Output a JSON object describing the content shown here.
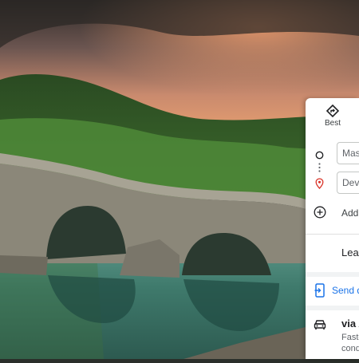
{
  "route_panel": {
    "travel_mode": {
      "label": "Best",
      "icon": "diamond-directions-icon"
    },
    "stops": [
      {
        "value": "Mass",
        "icon": "origin-circle-icon"
      },
      {
        "value": "Devi",
        "icon": "destination-pin-icon"
      }
    ],
    "add_destination_label": "Add",
    "leave_now_label": "Leav",
    "send_label": "Send d",
    "route": {
      "title": "via A",
      "detail_line1": "Faste",
      "detail_line2": "cond",
      "icon": "car-icon"
    },
    "accent_color": "#1a73e8"
  }
}
